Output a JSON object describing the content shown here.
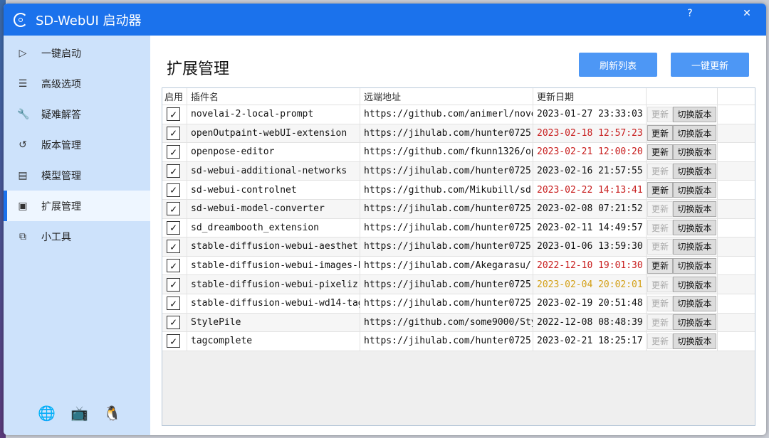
{
  "window": {
    "title": "SD-WebUI 启动器",
    "help": "?",
    "close": "✕"
  },
  "sidebar": {
    "items": [
      {
        "label": "一键启动",
        "icon": "play-icon",
        "glyph": "▷"
      },
      {
        "label": "高级选项",
        "icon": "list-icon",
        "glyph": "☰"
      },
      {
        "label": "疑难解答",
        "icon": "wrench-icon",
        "glyph": "🔧"
      },
      {
        "label": "版本管理",
        "icon": "history-icon",
        "glyph": "↺"
      },
      {
        "label": "模型管理",
        "icon": "archive-icon",
        "glyph": "▤"
      },
      {
        "label": "扩展管理",
        "icon": "chip-icon",
        "glyph": "▣",
        "active": true
      },
      {
        "label": "小工具",
        "icon": "toolbox-icon",
        "glyph": "⧉"
      }
    ],
    "footer": [
      {
        "icon": "globe-icon",
        "glyph": "🌐"
      },
      {
        "icon": "bilibili-icon",
        "glyph": "📺"
      },
      {
        "icon": "qq-icon",
        "glyph": "🐧"
      }
    ]
  },
  "main": {
    "title": "扩展管理",
    "refresh_label": "刷新列表",
    "update_all_label": "一键更新",
    "columns": [
      "启用",
      "插件名",
      "远端地址",
      "更新日期",
      ""
    ],
    "update_label": "更新",
    "switch_label": "切换版本",
    "colors": {
      "red": "#c81e1e",
      "amber": "#d4a017",
      "accent": "#1b72ec"
    },
    "rows": [
      {
        "enabled": true,
        "name": "novelai-2-local-prompt",
        "url": "https://github.com/animerl/nove",
        "date": "2023-01-27 23:33:03",
        "status": "normal",
        "can_update": false
      },
      {
        "enabled": true,
        "name": "openOutpaint-webUI-extension",
        "url": "https://jihulab.com/hunter0725,",
        "date": "2023-02-18 12:57:23",
        "status": "red",
        "can_update": true
      },
      {
        "enabled": true,
        "name": "openpose-editor",
        "url": "https://github.com/fkunn1326/op",
        "date": "2023-02-21 12:00:20",
        "status": "red",
        "can_update": true
      },
      {
        "enabled": true,
        "name": "sd-webui-additional-networks",
        "url": "https://jihulab.com/hunter0725,",
        "date": "2023-02-16 21:57:55",
        "status": "normal",
        "can_update": false
      },
      {
        "enabled": true,
        "name": "sd-webui-controlnet",
        "url": "https://github.com/Mikubill/sd-",
        "date": "2023-02-22 14:13:41",
        "status": "red",
        "can_update": true
      },
      {
        "enabled": true,
        "name": "sd-webui-model-converter",
        "url": "https://jihulab.com/hunter0725,",
        "date": "2023-02-08 07:21:52",
        "status": "normal",
        "can_update": false
      },
      {
        "enabled": true,
        "name": "sd_dreambooth_extension",
        "url": "https://jihulab.com/hunter0725,",
        "date": "2023-02-11 14:49:57",
        "status": "normal",
        "can_update": false
      },
      {
        "enabled": true,
        "name": "stable-diffusion-webui-aesthet:",
        "url": "https://jihulab.com/hunter0725,",
        "date": "2023-01-06 13:59:30",
        "status": "normal",
        "can_update": false
      },
      {
        "enabled": true,
        "name": "stable-diffusion-webui-images-b",
        "url": "https://jihulab.com/Akegarasu/:",
        "date": "2022-12-10 19:01:30",
        "status": "red",
        "can_update": true
      },
      {
        "enabled": true,
        "name": "stable-diffusion-webui-pixeliz:",
        "url": "https://jihulab.com/hunter0725,",
        "date": "2023-02-04 20:02:01",
        "status": "amber",
        "can_update": false
      },
      {
        "enabled": true,
        "name": "stable-diffusion-webui-wd14-tag",
        "url": "https://jihulab.com/hunter0725,",
        "date": "2023-02-19 20:51:48",
        "status": "normal",
        "can_update": false
      },
      {
        "enabled": true,
        "name": "StylePile",
        "url": "https://github.com/some9000/Sty",
        "date": "2022-12-08 08:48:39",
        "status": "normal",
        "can_update": false
      },
      {
        "enabled": true,
        "name": "tagcomplete",
        "url": "https://jihulab.com/hunter0725,",
        "date": "2023-02-21 18:25:17",
        "status": "normal",
        "can_update": false
      }
    ]
  }
}
